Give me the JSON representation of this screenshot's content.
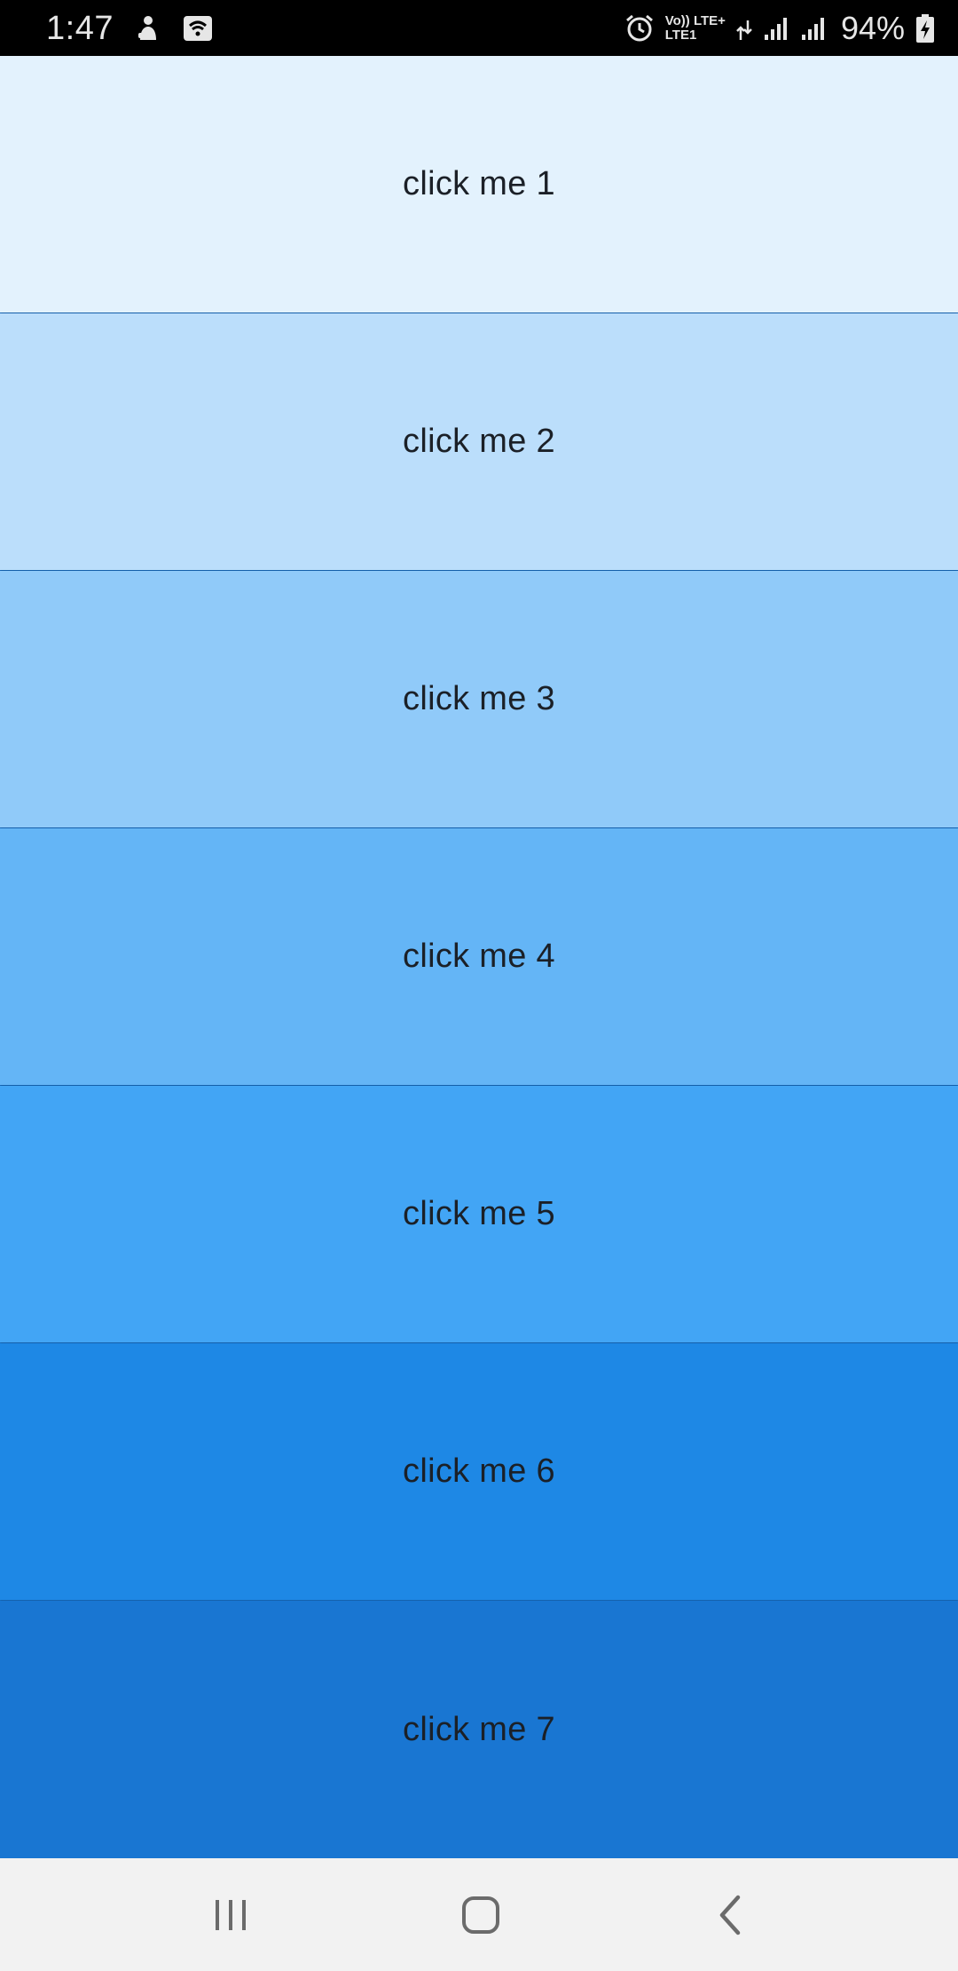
{
  "status_bar": {
    "time": "1:47",
    "network_top": "Vo)) LTE+",
    "network_bottom": "LTE1",
    "battery": "94%",
    "icons": [
      "notification-person-icon",
      "wifi-hotspot-icon",
      "alarm-icon",
      "data-arrows-icon",
      "signal-icon",
      "signal-icon",
      "battery-charging-icon"
    ]
  },
  "buttons": [
    {
      "label": "click me 1",
      "color": "#e3f2fd"
    },
    {
      "label": "click me 2",
      "color": "#bbdefb"
    },
    {
      "label": "click me 3",
      "color": "#90caf9"
    },
    {
      "label": "click me 4",
      "color": "#64b5f6"
    },
    {
      "label": "click me 5",
      "color": "#42a5f5"
    },
    {
      "label": "click me 6",
      "color": "#1e88e5"
    },
    {
      "label": "click me 7",
      "color": "#1976d2"
    }
  ],
  "nav_bar": {
    "icons": [
      "recents-icon",
      "home-icon",
      "back-icon"
    ],
    "background": "#f2f2f2"
  }
}
